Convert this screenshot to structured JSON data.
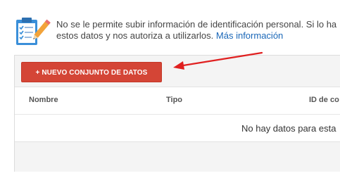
{
  "notice": {
    "line1": "No se le permite subir información de identificación personal. Si lo ha",
    "line2": "estos datos y nos autoriza a utilizarlos.",
    "link_label": "Más información",
    "icon": "clipboard-checklist-icon"
  },
  "toolbar": {
    "new_set_label": "+ NUEVO CONJUNTO DE DATOS"
  },
  "table": {
    "columns": [
      "Nombre",
      "Tipo",
      "ID de co"
    ],
    "empty_message": "No hay datos para esta"
  },
  "annotation": {
    "icon": "red-arrow-icon",
    "color": "#e02020"
  },
  "colors": {
    "accent": "#d44536",
    "link": "#1a67b8"
  }
}
